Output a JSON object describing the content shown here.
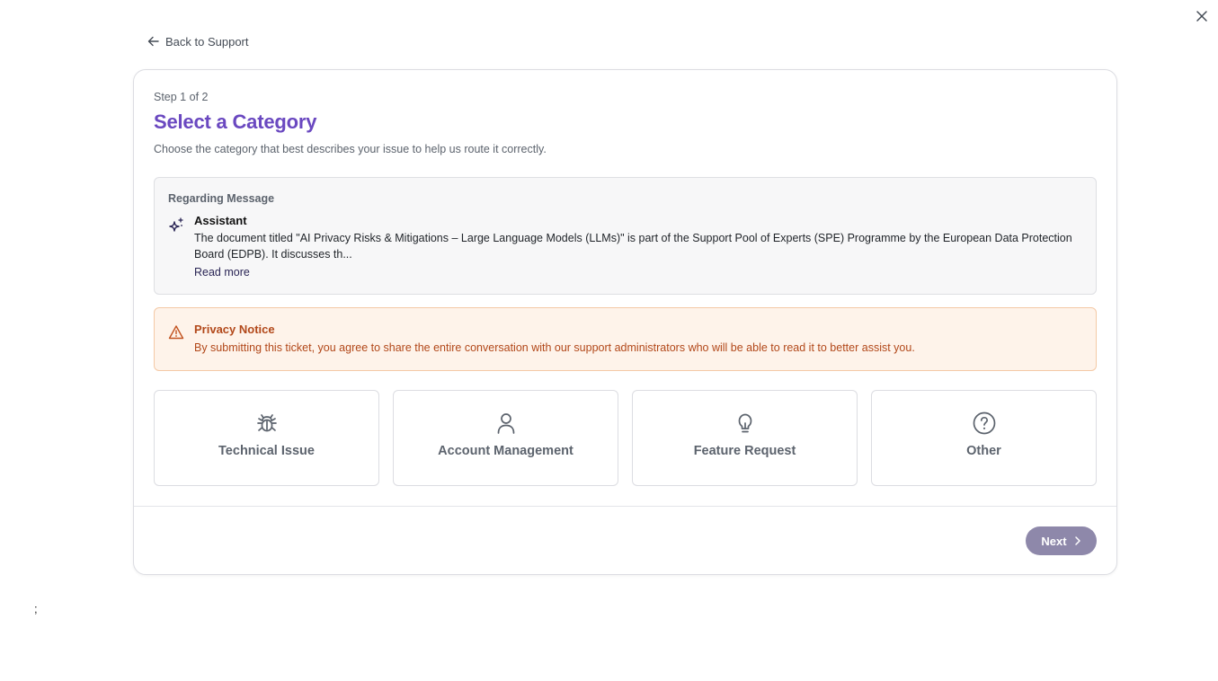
{
  "back_link": {
    "label": "Back to Support",
    "icon": "arrow-left-icon"
  },
  "close": {
    "icon": "close-icon"
  },
  "step": {
    "text": "Step 1 of 2"
  },
  "header": {
    "title": "Select a Category",
    "subtitle": "Choose the category that best describes your issue to help us route it correctly."
  },
  "message": {
    "heading": "Regarding Message",
    "author": "Assistant",
    "icon": "sparkles-icon",
    "excerpt": "The document titled \"AI Privacy Risks & Mitigations – Large Language Models (LLMs)\" is part of the Support Pool of Experts (SPE) Programme by the European Data Protection Board (EDPB). It discusses th...",
    "read_more": "Read more"
  },
  "notice": {
    "icon": "warning-triangle-icon",
    "title": "Privacy Notice",
    "text": "By submitting this ticket, you agree to share the entire conversation with our support administrators who will be able to read it to better assist you."
  },
  "categories": [
    {
      "label": "Technical Issue",
      "icon": "bug-icon"
    },
    {
      "label": "Account Management",
      "icon": "user-icon"
    },
    {
      "label": "Feature Request",
      "icon": "lightbulb-icon"
    },
    {
      "label": "Other",
      "icon": "question-circle-icon"
    }
  ],
  "footer": {
    "next_label": "Next",
    "next_icon": "chevron-right-icon"
  },
  "stray_text": ";",
  "colors": {
    "accent": "#6a48c0",
    "notice_bg": "#fef3ea",
    "notice_text": "#b2481a",
    "next_button": "#8e88aa"
  }
}
